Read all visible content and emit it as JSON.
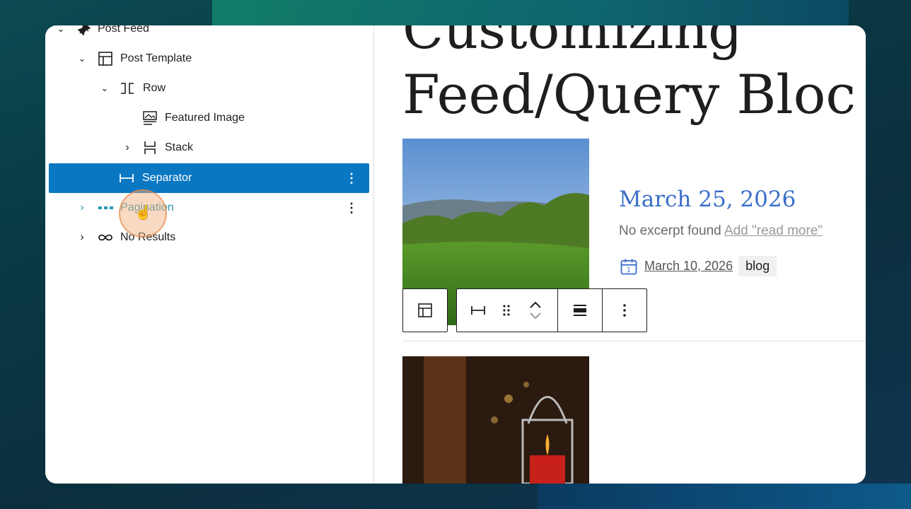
{
  "list_view": {
    "items": [
      {
        "label": "Post Feed",
        "icon": "pin-icon",
        "expanded": true
      },
      {
        "label": "Post Template",
        "icon": "layout-icon",
        "expanded": true
      },
      {
        "label": "Row",
        "icon": "row-icon",
        "expanded": true
      },
      {
        "label": "Featured Image",
        "icon": "featured-image-icon"
      },
      {
        "label": "Stack",
        "icon": "stack-icon",
        "expanded": false
      },
      {
        "label": "Separator",
        "icon": "separator-icon",
        "selected": true
      },
      {
        "label": "Pagination",
        "icon": "pagination-icon",
        "expanded": false
      },
      {
        "label": "No Results",
        "icon": "no-results-icon",
        "expanded": false
      }
    ]
  },
  "content": {
    "title_line1": "Customizing",
    "title_line2": "Feed/Query Bloc",
    "post": {
      "date_heading": "March 25, 2026",
      "excerpt": "No excerpt found",
      "read_more": "Add \"read more\"",
      "meta_date": "March 10, 2026",
      "tag": "blog"
    }
  },
  "colors": {
    "selected": "#0a77c2",
    "link": "#3a6ec9",
    "pagination": "#2a9ab0"
  }
}
